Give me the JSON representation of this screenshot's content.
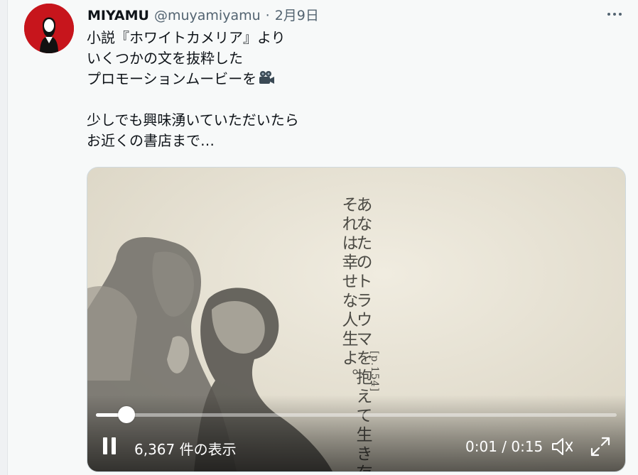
{
  "tweet": {
    "author_name": "MIYAMU",
    "handle": "@muyamiyamu",
    "separator": "·",
    "date": "2月9日",
    "lines": [
      "小説『ホワイトカメリア』より",
      "いくつかの文を抜粋した",
      "プロモーションムービーを",
      "",
      "少しでも興味湧いていただいたら",
      "お近くの書店まで…"
    ],
    "emoji_icon": "movie-camera-icon"
  },
  "video": {
    "overlay_text_main": "あなたのトラウマを抱えて生き存えるなら、",
    "overlay_text_second": "それは幸せな人生よ。",
    "overlay_ref": "[p.154]",
    "views_label": "6,367 件の表示",
    "time_label": "0:01 / 0:15",
    "progress": 0.058,
    "playing": true
  },
  "colors": {
    "avatar_bg": "#c7151c",
    "text_primary": "#0f1419",
    "text_secondary": "#536471",
    "video_bg": "#e8e3d4"
  }
}
